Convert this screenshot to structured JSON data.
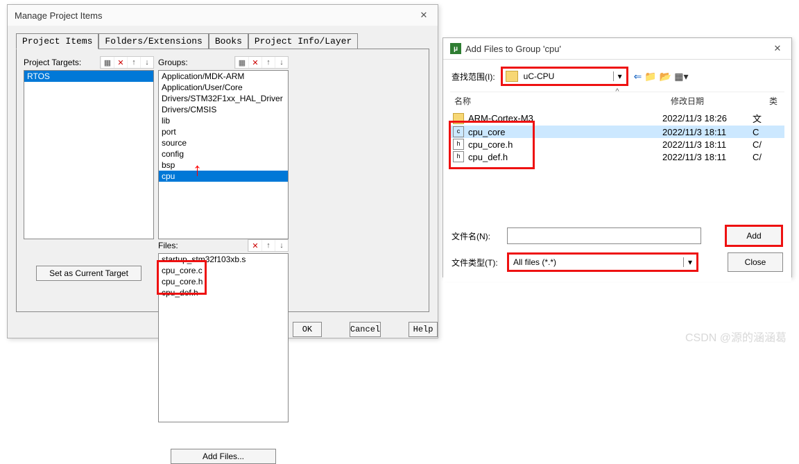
{
  "mpm": {
    "title": "Manage Project Items",
    "tabs": [
      "Project Items",
      "Folders/Extensions",
      "Books",
      "Project Info/Layer"
    ],
    "cols": {
      "targets_label": "Project Targets:",
      "groups_label": "Groups:",
      "files_label": "Files:"
    },
    "targets": [
      "RTOS"
    ],
    "groups": [
      "Application/MDK-ARM",
      "Application/User/Core",
      "Drivers/STM32F1xx_HAL_Driver",
      "Drivers/CMSIS",
      "lib",
      "port",
      "source",
      "config",
      "bsp",
      "cpu"
    ],
    "files": [
      "startup_stm32f103xb.s",
      "cpu_core.c",
      "cpu_core.h",
      "cpu_def.h"
    ],
    "btn_set_target": "Set as Current Target",
    "btn_add_files": "Add Files...",
    "btn_ok": "OK",
    "btn_cancel": "Cancel",
    "btn_help": "Help"
  },
  "add": {
    "title": "Add Files to Group 'cpu'",
    "lookin_label": "查找范围(I):",
    "lookin_value": "uC-CPU",
    "col_name": "名称",
    "col_date": "修改日期",
    "col_type": "类",
    "items": [
      {
        "name": "ARM-Cortex-M3",
        "kind": "folder",
        "date": "2022/11/3 18:26",
        "type": "文"
      },
      {
        "name": "cpu_core",
        "kind": "c",
        "date": "2022/11/3 18:11",
        "type": "C "
      },
      {
        "name": "cpu_core.h",
        "kind": "h",
        "date": "2022/11/3 18:11",
        "type": "C/"
      },
      {
        "name": "cpu_def.h",
        "kind": "h",
        "date": "2022/11/3 18:11",
        "type": "C/"
      }
    ],
    "filename_label": "文件名(N):",
    "filename_value": "",
    "filetype_label": "文件类型(T):",
    "filetype_value": "All files (*.*)",
    "btn_add": "Add",
    "btn_close": "Close"
  },
  "watermark": "CSDN @源的涵涵葛"
}
